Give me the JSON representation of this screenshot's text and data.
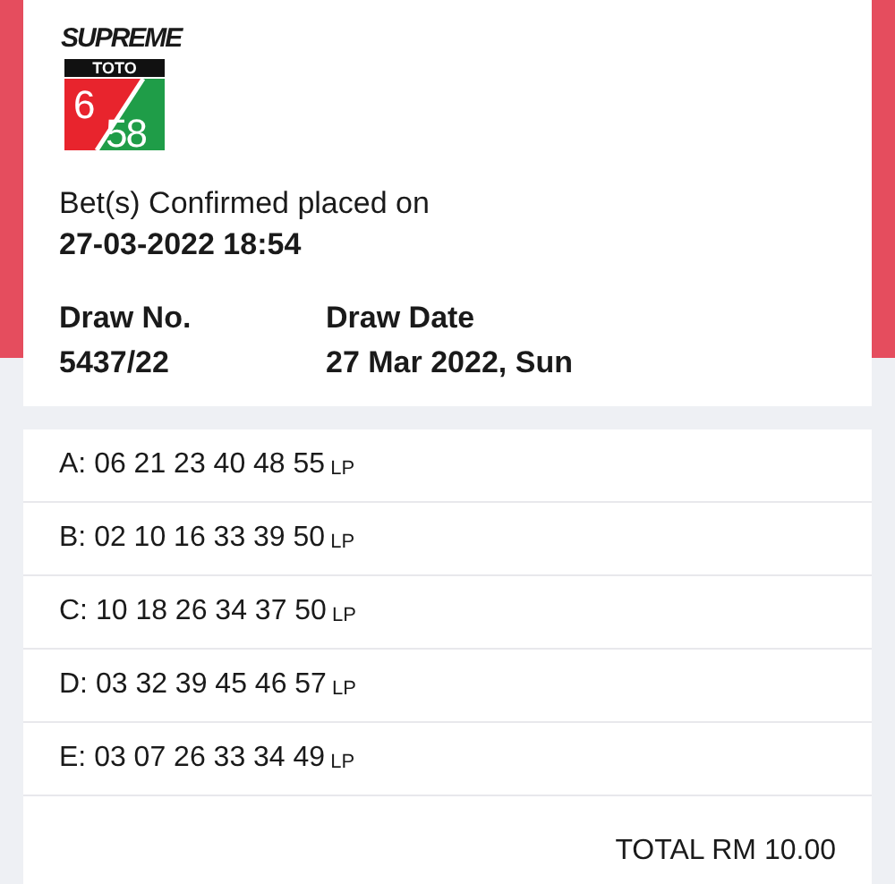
{
  "logo": {
    "brand": "SUPREME",
    "game": "TOTO",
    "left_digit": "6",
    "right_digits": "58"
  },
  "confirmation": {
    "label": "Bet(s) Confirmed placed on",
    "datetime": "27-03-2022 18:54"
  },
  "draw": [
    {
      "label": "Draw No.",
      "value": "5437/22"
    },
    {
      "label": "Draw Date",
      "value": "27 Mar 2022, Sun"
    }
  ],
  "bets": [
    {
      "line": "A: 06 21 23 40 48 55",
      "tag": "LP"
    },
    {
      "line": "B: 02 10 16 33 39 50",
      "tag": "LP"
    },
    {
      "line": "C: 10 18 26 34 37 50",
      "tag": "LP"
    },
    {
      "line": "D: 03 32 39 45 46 57",
      "tag": "LP"
    },
    {
      "line": "E: 03 07 26 33 34 49",
      "tag": "LP"
    }
  ],
  "total": "TOTAL RM 10.00"
}
